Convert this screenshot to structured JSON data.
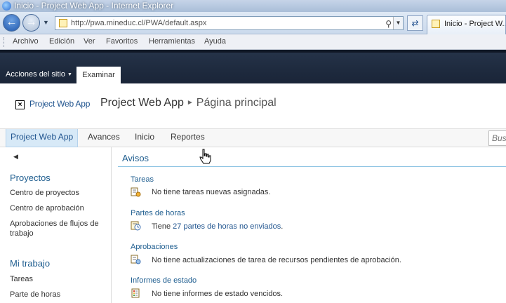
{
  "browser": {
    "title": "Inicio - Project Web App - Internet Explorer",
    "address": "http://pwa.mineduc.cl/PWA/default.aspx",
    "tab_label": "Inicio - Project W...",
    "menu": [
      "Archivo",
      "Edición",
      "Ver",
      "Favoritos",
      "Herramientas",
      "Ayuda"
    ]
  },
  "ribbon": {
    "site_actions": "Acciones del sitio",
    "tab": "Examinar"
  },
  "header": {
    "site_link": "Project Web App",
    "title": "Project Web App",
    "current_page": "Página principal"
  },
  "topnav": {
    "items": [
      "Project Web App",
      "Avances",
      "Inicio",
      "Reportes"
    ],
    "search_placeholder": "Bus"
  },
  "leftnav": {
    "sections": [
      {
        "heading": "Proyectos",
        "items": [
          "Centro de proyectos",
          "Centro de aprobación",
          "Aprobaciones de flujos de trabajo"
        ]
      },
      {
        "heading": "Mi trabajo",
        "items": [
          "Tareas",
          "Parte de horas"
        ]
      }
    ]
  },
  "content": {
    "title": "Avisos",
    "sections": [
      {
        "title": "Tareas",
        "icon": "tasks-icon",
        "text": "No tiene tareas nuevas asignadas."
      },
      {
        "title": "Partes de horas",
        "icon": "timesheet-icon",
        "text_prefix": "Tiene ",
        "link": "27 partes de horas no enviados",
        "text_suffix": "."
      },
      {
        "title": "Aprobaciones",
        "icon": "approvals-icon",
        "text": "No tiene actualizaciones de tarea de recursos pendientes de aprobación."
      },
      {
        "title": "Informes de estado",
        "icon": "status-report-icon",
        "text": "No tiene informes de estado vencidos."
      }
    ]
  }
}
